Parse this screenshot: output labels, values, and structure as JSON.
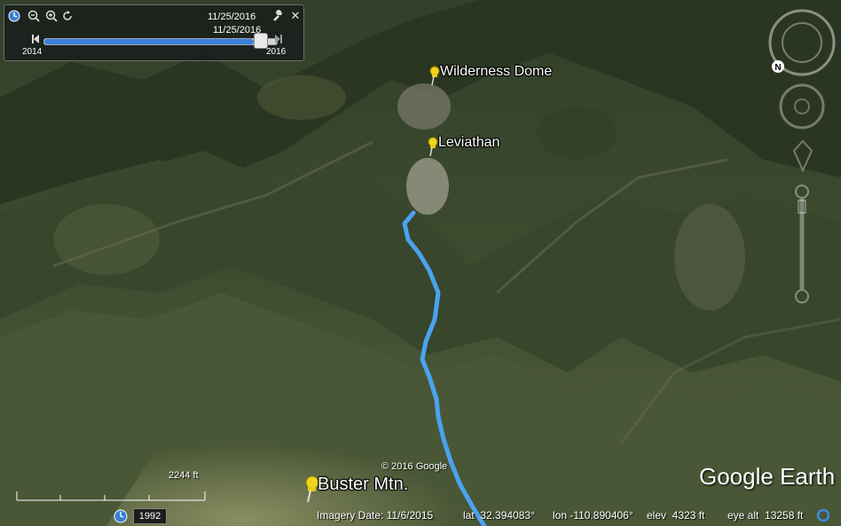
{
  "time_slider": {
    "current_date": "11/25/2016",
    "thumb_date": "11/25/2016",
    "start_year": "2014",
    "end_year": "2016",
    "position_fraction": 0.9
  },
  "placemarks": [
    {
      "label": "Wilderness Dome"
    },
    {
      "label": "Leviathan"
    },
    {
      "label": "Buster Mtn."
    }
  ],
  "track_color": "#4aa3f0",
  "copyright": "© 2016 Google",
  "logo": "Google Earth",
  "scale": {
    "label": "2244 ft"
  },
  "historical_year": "1992",
  "status": {
    "imagery_date": "Imagery Date: 11/6/2015",
    "lat": "lat  32.394083°",
    "lon": "lon -110.890406°",
    "elev": "elev  4323 ft",
    "eye_alt": "eye alt  13258 ft"
  },
  "icons": [
    "clock-icon",
    "zoom-out-icon",
    "zoom-in-icon",
    "refresh-icon",
    "wrench-icon",
    "close-icon",
    "skip-start-icon",
    "skip-end-icon",
    "compass-icon",
    "look-icon",
    "move-icon",
    "zoom-slider",
    "pushpin-icon",
    "status-globe-icon"
  ]
}
